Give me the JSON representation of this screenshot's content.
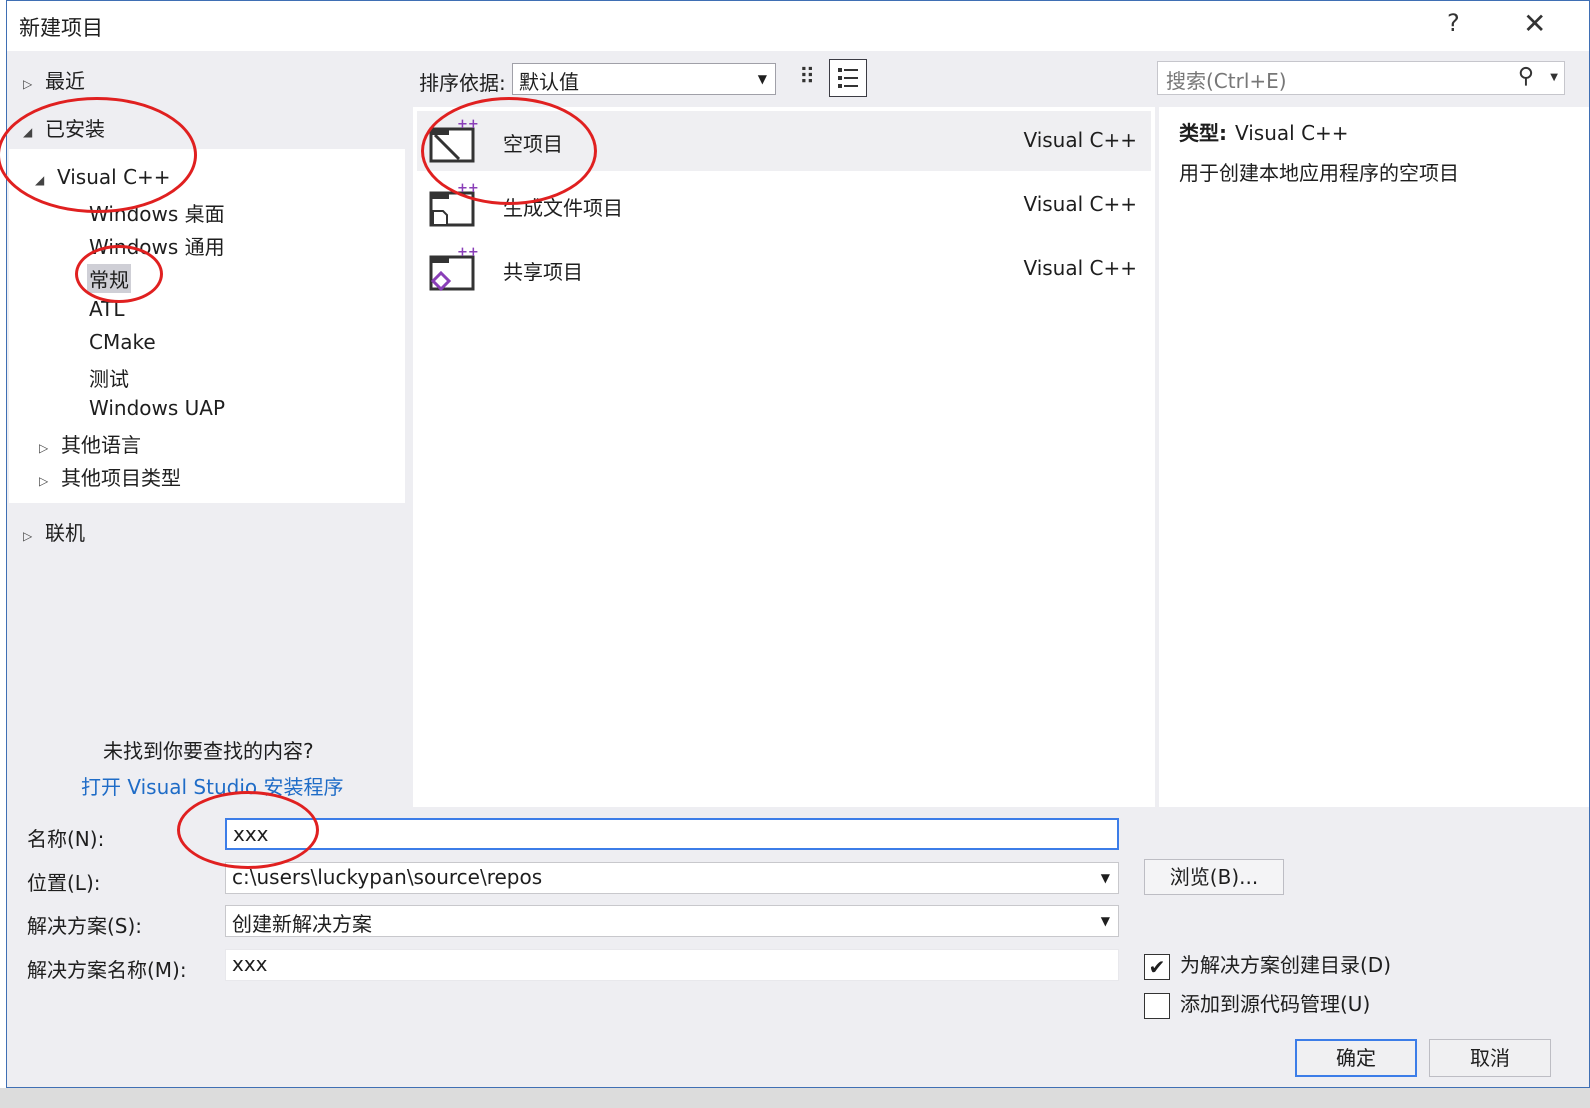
{
  "title": "新建项目",
  "title_buttons": {
    "help": "?",
    "close": "✕"
  },
  "tree": {
    "recent": "最近",
    "installed": "已安装",
    "visual_cpp": "Visual C++",
    "children": [
      "Windows 桌面",
      "Windows 通用",
      "常规",
      "ATL",
      "CMake",
      "测试",
      "Windows UAP"
    ],
    "other_languages": "其他语言",
    "other_project_types": "其他项目类型",
    "online": "联机",
    "not_found_hint": "未找到你要查找的内容?",
    "installer_link": "打开 Visual Studio 安装程序"
  },
  "toolbar": {
    "sort_label": "排序依据:",
    "sort_value": "默认值",
    "search_placeholder": "搜索(Ctrl+E)"
  },
  "templates": [
    {
      "name": "空项目",
      "lang": "Visual C++",
      "icon": "empty-project-icon"
    },
    {
      "name": "生成文件项目",
      "lang": "Visual C++",
      "icon": "makefile-project-icon"
    },
    {
      "name": "共享项目",
      "lang": "Visual C++",
      "icon": "shared-project-icon"
    }
  ],
  "description": {
    "type_label": "类型:",
    "type_value": "Visual C++",
    "text": "用于创建本地应用程序的空项目"
  },
  "form": {
    "name_label": "名称(N):",
    "name_value": "xxx",
    "location_label": "位置(L):",
    "location_value": "c:\\users\\luckypan\\source\\repos",
    "solution_label": "解决方案(S):",
    "solution_value": "创建新解决方案",
    "solution_name_label": "解决方案名称(M):",
    "solution_name_value": "xxx",
    "browse_label": "浏览(B)...",
    "create_dir_label": "为解决方案创建目录(D)",
    "create_dir_checked": true,
    "source_control_label": "添加到源代码管理(U)",
    "source_control_checked": false,
    "ok_label": "确定",
    "cancel_label": "取消"
  },
  "colors": {
    "accent": "#3c7de8",
    "link": "#1f6cc7",
    "annotation": "#e02020",
    "template_icon_plus": "#8a3fb8"
  }
}
